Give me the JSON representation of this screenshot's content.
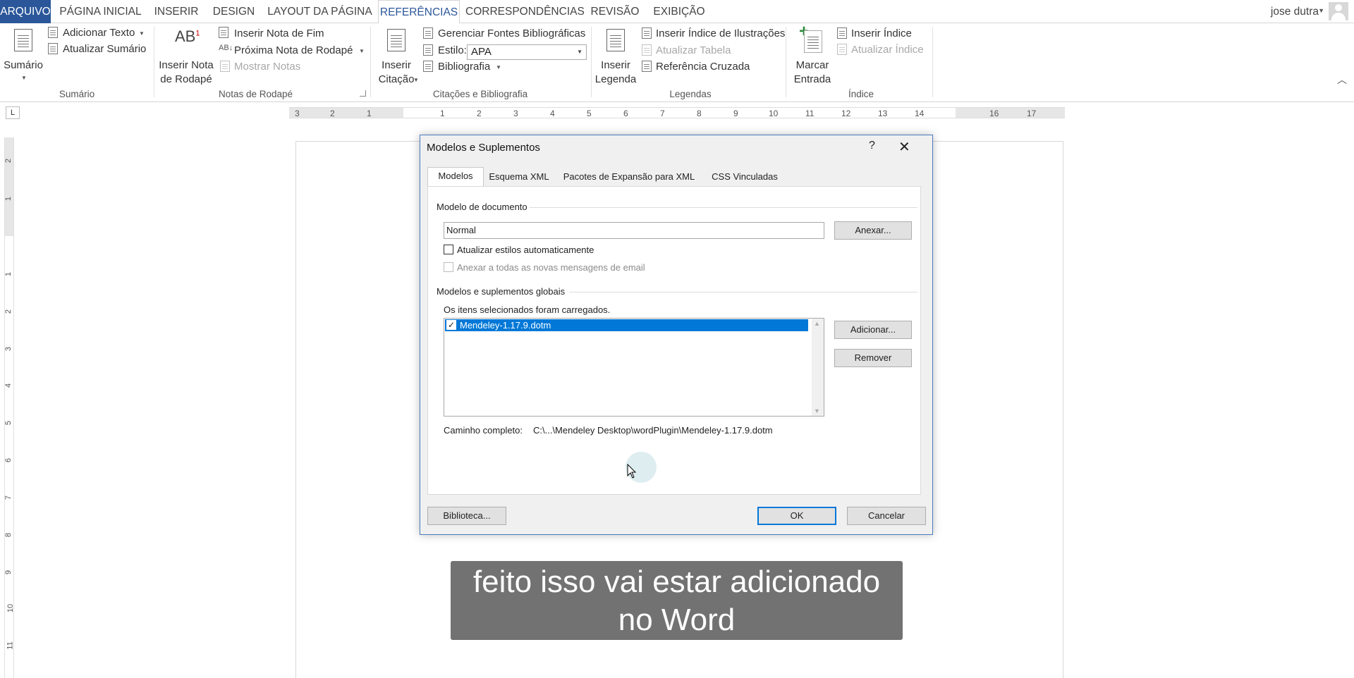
{
  "ribbon_tabs": [
    {
      "label": "ARQUIVO"
    },
    {
      "label": "PÁGINA INICIAL"
    },
    {
      "label": "INSERIR"
    },
    {
      "label": "DESIGN"
    },
    {
      "label": "LAYOUT DA PÁGINA"
    },
    {
      "label": "REFERÊNCIAS"
    },
    {
      "label": "CORRESPONDÊNCIAS"
    },
    {
      "label": "REVISÃO"
    },
    {
      "label": "EXIBIÇÃO"
    }
  ],
  "user": {
    "name": "jose dutra"
  },
  "ribbon": {
    "sumario": {
      "big_label": "Sumário",
      "adicionar_texto": "Adicionar Texto",
      "atualizar_sumario": "Atualizar Sumário",
      "group": "Sumário"
    },
    "notas": {
      "big_label_1": "Inserir Nota",
      "big_label_2": "de Rodapé",
      "inserir_nota_fim": "Inserir Nota de Fim",
      "proxima_nota": "Próxima Nota de Rodapé",
      "mostrar_notas": "Mostrar Notas",
      "group": "Notas de Rodapé"
    },
    "citacoes": {
      "big_label_1": "Inserir",
      "big_label_2": "Citação",
      "gerenciar_fontes": "Gerenciar Fontes Bibliográficas",
      "estilo_label": "Estilo:",
      "estilo_value": "APA",
      "bibliografia": "Bibliografia",
      "group": "Citações e Bibliografia"
    },
    "legendas": {
      "big_label_1": "Inserir",
      "big_label_2": "Legenda",
      "inserir_indice_ilustracoes": "Inserir Índice de Ilustrações",
      "atualizar_tabela": "Atualizar Tabela",
      "referencia_cruzada": "Referência Cruzada",
      "group": "Legendas"
    },
    "indice": {
      "big_label_1": "Marcar",
      "big_label_2": "Entrada",
      "inserir_indice": "Inserir Índice",
      "atualizar_indice": "Atualizar Índice",
      "group": "Índice"
    }
  },
  "ruler": {
    "tab_selector": "L",
    "h_numbers": [
      "3",
      "2",
      "1",
      "1",
      "2",
      "3",
      "4",
      "5",
      "6",
      "7",
      "8",
      "9",
      "10",
      "11",
      "12",
      "13",
      "14",
      "16",
      "17"
    ],
    "v_numbers": [
      "2",
      "1",
      "1",
      "2",
      "3",
      "4",
      "5",
      "6",
      "7",
      "8",
      "9",
      "10",
      "11"
    ]
  },
  "dialog": {
    "title": "Modelos e Suplementos",
    "help": "?",
    "close": "✕",
    "tabs": [
      "Modelos",
      "Esquema XML",
      "Pacotes de Expansão para XML",
      "CSS Vinculadas"
    ],
    "modelo_documento_label": "Modelo de documento",
    "modelo_documento_value": "Normal",
    "anexar_button": "Anexar...",
    "atualizar_estilos": "Atualizar estilos automaticamente",
    "anexar_email": "Anexar a todas as novas mensagens de email",
    "globais_label": "Modelos e suplementos globais",
    "globais_hint": "Os itens selecionados foram carregados.",
    "addins": [
      {
        "name": "Mendeley-1.17.9.dotm",
        "checked": true
      }
    ],
    "adicionar_button": "Adicionar...",
    "remover_button": "Remover",
    "caminho_label": "Caminho completo:",
    "caminho_value": "C:\\...\\Mendeley Desktop\\wordPlugin\\Mendeley-1.17.9.dotm",
    "biblioteca_button": "Biblioteca...",
    "ok_button": "OK",
    "cancelar_button": "Cancelar"
  },
  "subtitle": {
    "line1": "feito isso vai estar adicionado",
    "line2": "no Word"
  },
  "colors": {
    "accent": "#2b579a",
    "selection": "#0078d7"
  }
}
